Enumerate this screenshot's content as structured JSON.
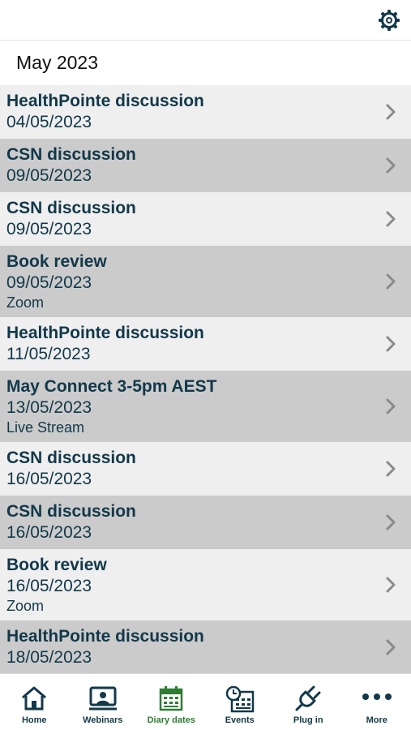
{
  "header": {
    "settings_icon": "gear-icon",
    "month": "May 2023"
  },
  "colors": {
    "text_primary": "#12384a",
    "row_light": "#efefef",
    "row_dark": "#cbcbcb",
    "active_tab": "#2e7d32"
  },
  "events": [
    {
      "title": "HealthPointe discussion",
      "date": "04/05/2023",
      "location": ""
    },
    {
      "title": "CSN discussion",
      "date": "09/05/2023",
      "location": ""
    },
    {
      "title": "CSN discussion",
      "date": "09/05/2023",
      "location": ""
    },
    {
      "title": "Book review",
      "date": "09/05/2023",
      "location": "Zoom"
    },
    {
      "title": "HealthPointe discussion",
      "date": "11/05/2023",
      "location": ""
    },
    {
      "title": "May Connect 3-5pm AEST",
      "date": "13/05/2023",
      "location": "Live Stream"
    },
    {
      "title": "CSN discussion",
      "date": "16/05/2023",
      "location": ""
    },
    {
      "title": "CSN discussion",
      "date": "16/05/2023",
      "location": ""
    },
    {
      "title": "Book review",
      "date": "16/05/2023",
      "location": "Zoom"
    },
    {
      "title": "HealthPointe discussion",
      "date": "18/05/2023",
      "location": ""
    }
  ],
  "tabs": [
    {
      "label": "Home",
      "icon": "home-icon",
      "active": false
    },
    {
      "label": "Webinars",
      "icon": "webinar-icon",
      "active": false
    },
    {
      "label": "Diary dates",
      "icon": "calendar-icon",
      "active": true
    },
    {
      "label": "Events",
      "icon": "events-calendar-clock-icon",
      "active": false
    },
    {
      "label": "Plug in",
      "icon": "plug-icon",
      "active": false
    },
    {
      "label": "More",
      "icon": "more-dots-icon",
      "active": false
    }
  ]
}
